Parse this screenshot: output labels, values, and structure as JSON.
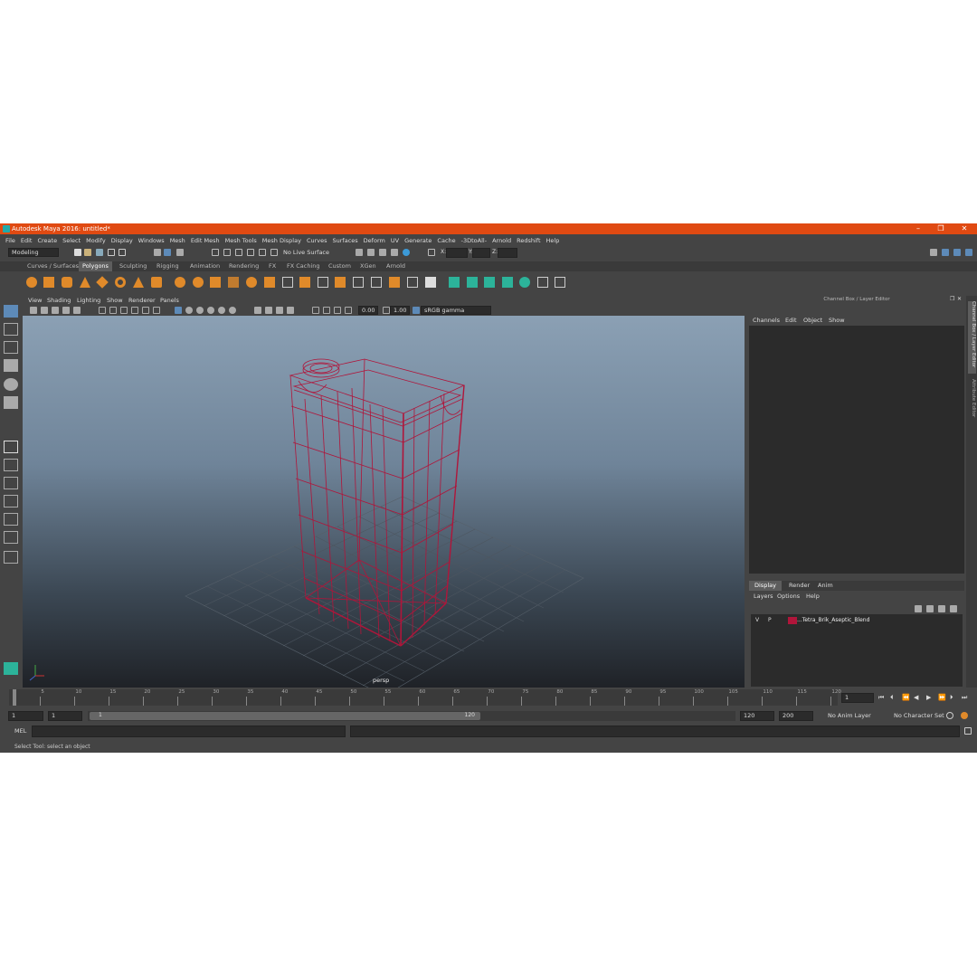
{
  "title": "Autodesk Maya 2016: untitled*",
  "window_controls": [
    "–",
    "❐",
    "✕"
  ],
  "menu": [
    "File",
    "Edit",
    "Create",
    "Select",
    "Modify",
    "Display",
    "Windows",
    "Mesh",
    "Edit Mesh",
    "Mesh Tools",
    "Mesh Display",
    "Curves",
    "Surfaces",
    "Deform",
    "UV",
    "Generate",
    "Cache",
    "-3DtoAll-",
    "Arnold",
    "Redshift",
    "Help"
  ],
  "mode": "Modeling",
  "live_surface": "No Live Surface",
  "xyz": [
    "X:",
    "Y:",
    "Z:"
  ],
  "shelf_tabs": [
    "Curves / Surfaces",
    "Polygons",
    "Sculpting",
    "Rigging",
    "Animation",
    "Rendering",
    "FX",
    "FX Caching",
    "Custom",
    "XGen",
    "Arnold"
  ],
  "active_shelf": "Polygons",
  "viewport_menu": [
    "View",
    "Shading",
    "Lighting",
    "Show",
    "Renderer",
    "Panels"
  ],
  "viewport_values": {
    "exposure": "0.00",
    "gamma": "1.00",
    "colorspace": "sRGB gamma"
  },
  "camera_label": "persp",
  "panel_title": "Channel Box / Layer Editor",
  "channel_menu": [
    "Channels",
    "Edit",
    "Object",
    "Show"
  ],
  "layer_tabs": [
    "Display",
    "Render",
    "Anim"
  ],
  "layer_menu": [
    "Layers",
    "Options",
    "Help"
  ],
  "layer": {
    "v": "V",
    "p": "P",
    "name": "...Tetra_Brik_Aseptic_Blend",
    "color": "#b0153a"
  },
  "side_tabs": [
    "Channel Box / Layer Editor",
    "Attribute Editor"
  ],
  "timeline_ticks": [
    "5",
    "10",
    "15",
    "20",
    "25",
    "30",
    "35",
    "40",
    "45",
    "50",
    "55",
    "60",
    "65",
    "70",
    "75",
    "80",
    "85",
    "90",
    "95",
    "100",
    "105",
    "110",
    "115",
    "120"
  ],
  "current_frame": "1",
  "range": {
    "start": "1",
    "start2": "1",
    "slider_start": "1",
    "slider_end": "120",
    "end": "120",
    "end2": "200"
  },
  "anim_layer": "No Anim Layer",
  "char_set": "No Character Set",
  "mel_label": "MEL",
  "help_line": "Select Tool: select an object",
  "colors": {
    "accent": "#e04a12",
    "wire": "#b0153a"
  }
}
